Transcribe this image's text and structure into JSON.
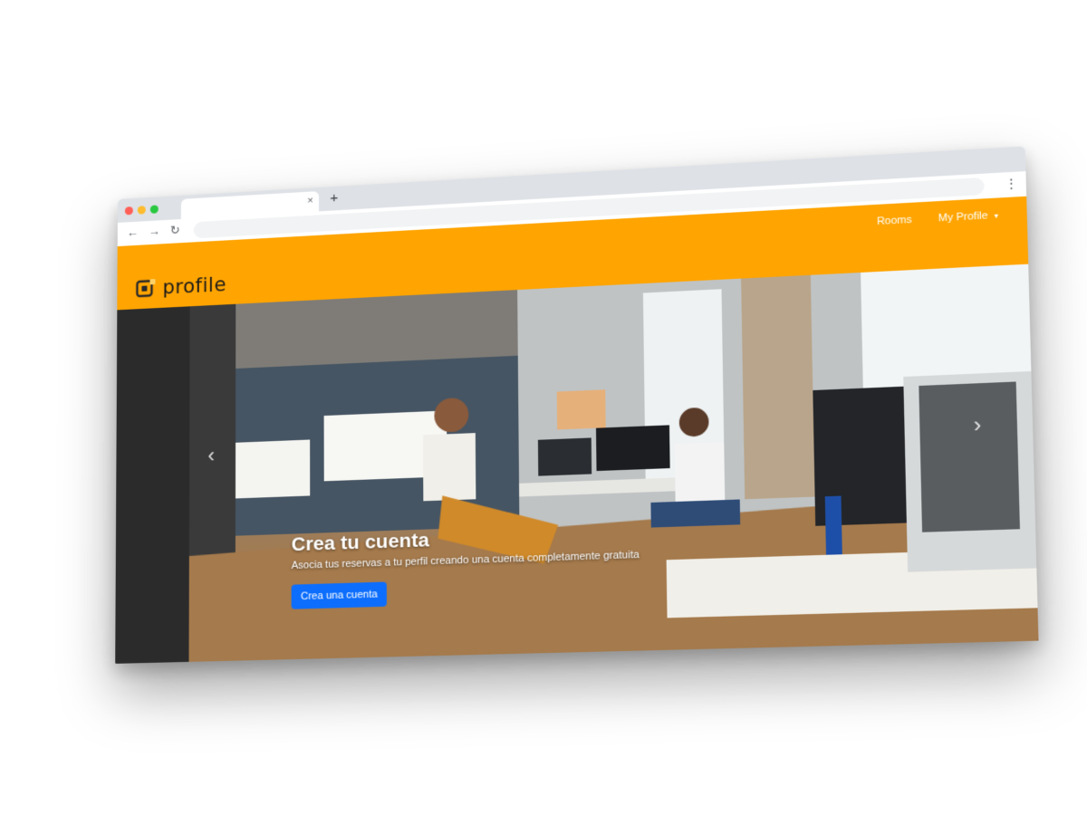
{
  "browser": {
    "tab_close": "×",
    "new_tab": "+",
    "back_icon": "←",
    "forward_icon": "→",
    "reload_icon": "↻",
    "menu_icon": "⋮"
  },
  "navbar": {
    "background": "#ffa400",
    "links": [
      {
        "label": "Rooms"
      },
      {
        "label": "My Profile",
        "caret": "▾"
      }
    ]
  },
  "brand": {
    "logo_text": "profile"
  },
  "hero": {
    "prev_icon": "‹",
    "next_icon": "›",
    "title": "Crea tu cuenta",
    "subtitle": "Asocia tus reservas a tu perfil creando una cuenta completamente gratuita",
    "cta_label": "Crea una cuenta",
    "cta_color": "#0d6efd"
  }
}
